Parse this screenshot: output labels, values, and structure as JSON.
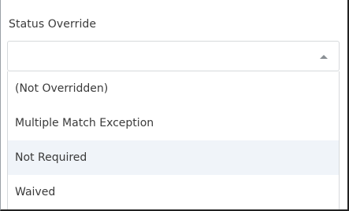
{
  "field": {
    "label": "Status Override",
    "selected_value": ""
  },
  "dropdown": {
    "options": [
      {
        "label": "(Not Overridden)"
      },
      {
        "label": "Multiple Match Exception"
      },
      {
        "label": "Not Required"
      },
      {
        "label": "Waived"
      }
    ],
    "hovered_index": 2
  },
  "icons": {
    "caret": "caret-up-icon"
  },
  "colors": {
    "hover_background": "#f0f4f9",
    "border": "#d6d9dc",
    "text": "#3a3a3a"
  }
}
